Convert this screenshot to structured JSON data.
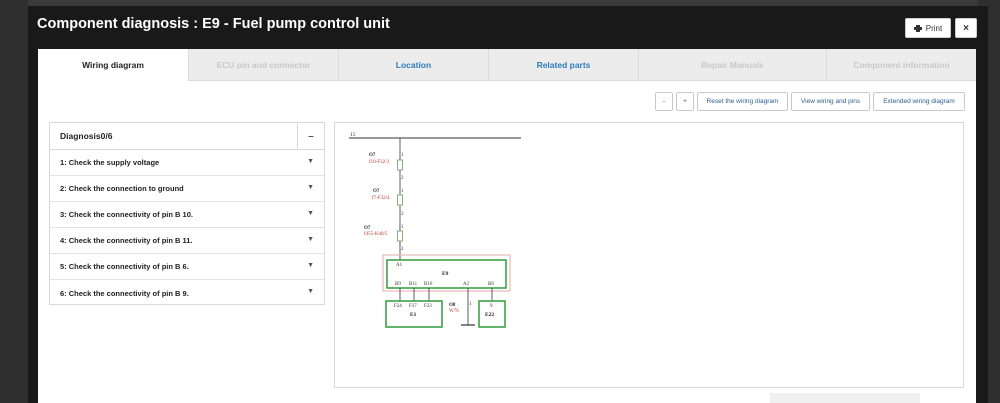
{
  "modal": {
    "title": "Component diagnosis : E9 - Fuel pump control unit",
    "print_label": "Print",
    "close_label": "×"
  },
  "tabs": [
    {
      "label": "Wiring diagram",
      "state": "active"
    },
    {
      "label": "ECU pin and connector",
      "state": "disabled"
    },
    {
      "label": "Location",
      "state": "link"
    },
    {
      "label": "Related parts",
      "state": "link"
    },
    {
      "label": "Repair Manuals",
      "state": "disabled"
    },
    {
      "label": "Component information",
      "state": "disabled"
    }
  ],
  "toolbar": {
    "zoom_out": "-",
    "zoom_in": "+",
    "reset": "Reset the wiring diagram",
    "view_pins": "View wiring and pins",
    "extended": "Extended wiring diagram"
  },
  "diagnosis": {
    "header": "Diagnosis0/6",
    "collapse": "–",
    "items": [
      "1: Check the supply voltage",
      "2: Check the connection to ground",
      "3: Check the connectivity of pin B 10.",
      "4: Check the connectivity of pin B 11.",
      "5: Check the connectivity of pin B 6.",
      "6: Check the connectivity of pin B 9."
    ]
  },
  "wiring": {
    "rail": "15",
    "fuses": [
      {
        "wire": "O7",
        "ref": "f10-F32/3",
        "pin_in": "1",
        "pin_out": "2"
      },
      {
        "wire": "O7",
        "ref": "f7-F32/4",
        "pin_in": "1",
        "pin_out": "2"
      },
      {
        "wire": "O7",
        "ref": "f455-K40/5",
        "pin_in": "1",
        "pin_out": "2"
      }
    ],
    "ecu": {
      "name": "E9",
      "pin_top": "A1",
      "pins": [
        "B9",
        "B11",
        "B10",
        "A2",
        "B6"
      ]
    },
    "e1": {
      "name": "E1",
      "pins": [
        "F24",
        "F17",
        "F23"
      ]
    },
    "ground": {
      "wire": "O8",
      "ref": "W76",
      "pin": "1"
    },
    "e22": {
      "name": "E22",
      "pin": "9"
    },
    "colors": {
      "line": "#333333",
      "box": "#2e9e3a",
      "fuse": "#6b9e5a",
      "ref": "#c0392b",
      "highlight": "#e9b7b7"
    }
  }
}
